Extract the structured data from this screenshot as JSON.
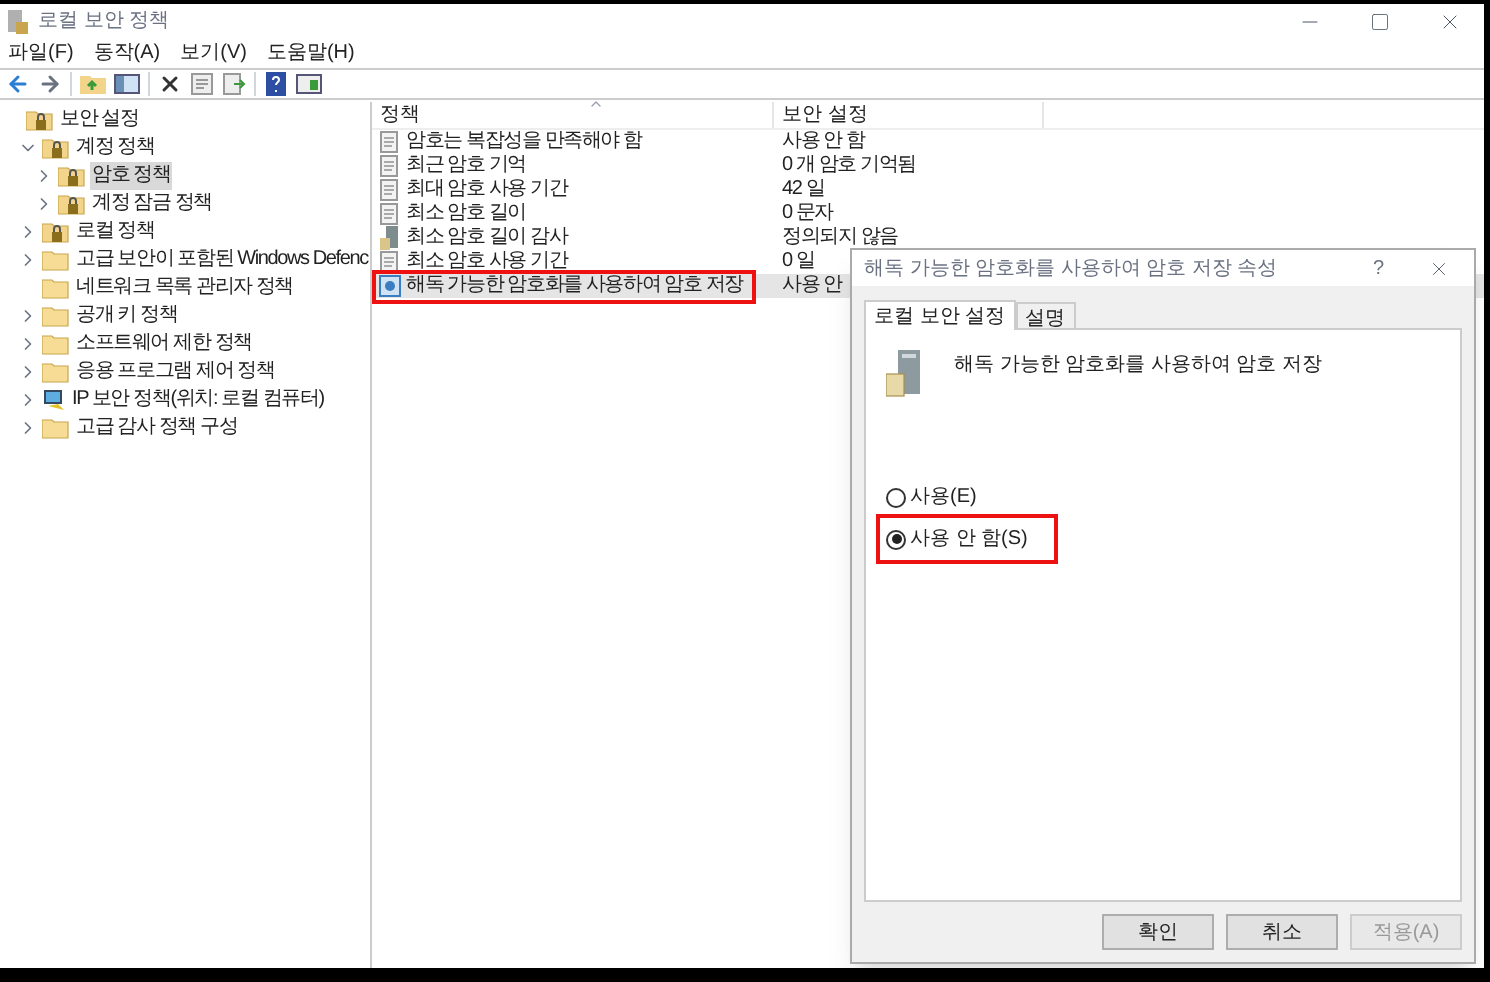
{
  "window": {
    "title": "로컬 보안 정책"
  },
  "menu": [
    {
      "label": "파일(F)"
    },
    {
      "label": "동작(A)"
    },
    {
      "label": "보기(V)"
    },
    {
      "label": "도움말(H)"
    }
  ],
  "tree": [
    {
      "label": "보안 설정",
      "kind": "folder-lock",
      "selected": false,
      "children": [
        {
          "label": "계정 정책",
          "kind": "folder-lock",
          "expanded": true,
          "selected": false,
          "children": [
            {
              "label": "암호 정책",
              "kind": "folder-lock",
              "expanded": false,
              "selected": true
            },
            {
              "label": "계정 잠금 정책",
              "kind": "folder-lock",
              "expanded": false,
              "selected": false
            }
          ]
        },
        {
          "label": "로컬 정책",
          "kind": "folder-lock",
          "expanded": false,
          "selected": false
        },
        {
          "label": "고급 보안이 포함된 Windows Defenc",
          "kind": "folder",
          "expanded": false,
          "selected": false
        },
        {
          "label": "네트워크 목록 관리자 정책",
          "kind": "folder",
          "selected": false
        },
        {
          "label": "공개 키 정책",
          "kind": "folder",
          "expanded": false,
          "selected": false
        },
        {
          "label": "소프트웨어 제한 정책",
          "kind": "folder",
          "expanded": false,
          "selected": false
        },
        {
          "label": "응용 프로그램 제어 정책",
          "kind": "folder",
          "expanded": false,
          "selected": false
        },
        {
          "label": "IP 보안 정책(위치: 로컬 컴퓨터)",
          "kind": "network",
          "expanded": false,
          "selected": false
        },
        {
          "label": "고급 감사 정책 구성",
          "kind": "folder",
          "expanded": false,
          "selected": false
        }
      ]
    }
  ],
  "list": {
    "columns": [
      "정책",
      "보안 설정"
    ],
    "rows": [
      {
        "policy": "암호는 복잡성을 만족해야 함",
        "setting": "사용 안 함",
        "kind": "policy",
        "selected": false,
        "highlighted": false
      },
      {
        "policy": "최근 암호 기억",
        "setting": "0 개 암호 기억됨",
        "kind": "policy",
        "selected": false,
        "highlighted": false
      },
      {
        "policy": "최대 암호 사용 기간",
        "setting": "42 일",
        "kind": "policy",
        "selected": false,
        "highlighted": false
      },
      {
        "policy": "최소 암호 길이",
        "setting": "0 문자",
        "kind": "policy",
        "selected": false,
        "highlighted": false
      },
      {
        "policy": "최소 암호 길이 감사",
        "setting": "정의되지 않음",
        "kind": "audit",
        "selected": false,
        "highlighted": false
      },
      {
        "policy": "최소 암호 사용 기간",
        "setting": "0 일",
        "kind": "policy",
        "selected": false,
        "highlighted": false
      },
      {
        "policy": "해독 가능한 암호화를 사용하여 암호 저장",
        "setting": "사용 안",
        "kind": "encrypt",
        "selected": true,
        "highlighted": true
      }
    ]
  },
  "dialog": {
    "title": "해독 가능한 암호화를 사용하여 암호 저장 속성",
    "help": "?",
    "tabs": [
      {
        "label": "로컬 보안 설정",
        "selected": true
      },
      {
        "label": "설명",
        "selected": false
      }
    ],
    "heading": "해독 가능한 암호화를 사용하여 암호 저장",
    "options": [
      {
        "label": "사용(E)",
        "selected": false,
        "highlighted": false
      },
      {
        "label": "사용 안 함(S)",
        "selected": true,
        "highlighted": true
      }
    ],
    "buttons": [
      {
        "label": "확인",
        "disabled": false
      },
      {
        "label": "취소",
        "disabled": false
      },
      {
        "label": "적용(A)",
        "disabled": true
      }
    ]
  }
}
